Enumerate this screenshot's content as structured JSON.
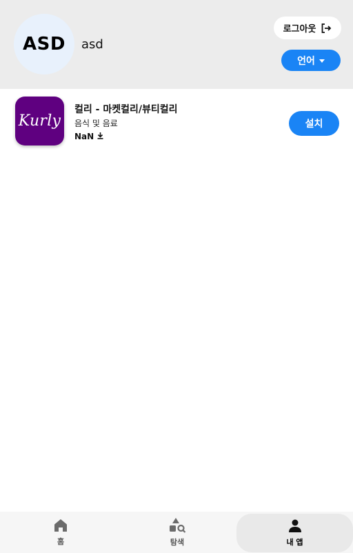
{
  "profile": {
    "avatar_initials": "ASD",
    "username": "asd"
  },
  "header": {
    "logout_label": "로그아웃",
    "language_label": "언어"
  },
  "apps": [
    {
      "title": "컬리 - 마켓컬리/뷰티컬리",
      "category": "음식 및 음료",
      "downloads": "NaN",
      "icon_text": "Kurly",
      "install_label": "설치"
    }
  ],
  "bottom_nav": {
    "home_label": "홈",
    "explore_label": "탐색",
    "myapps_label": "내 앱",
    "active": "myapps"
  },
  "colors": {
    "accent": "#1a84f5",
    "header_bg": "#ececec",
    "avatar_bg": "#e8f1fc",
    "kurly_purple": "#5f0080"
  }
}
